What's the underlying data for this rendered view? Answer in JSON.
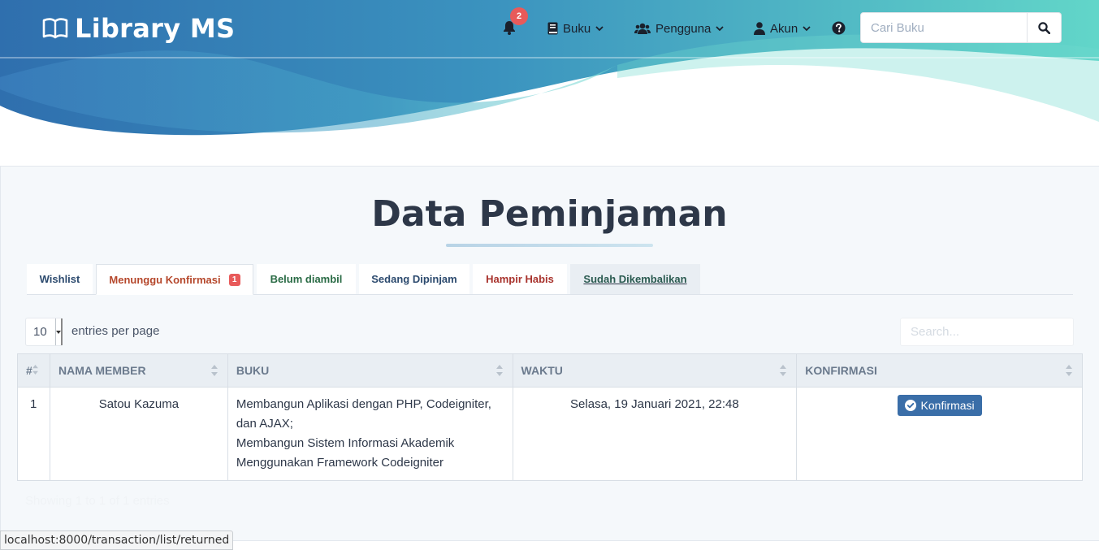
{
  "brand": {
    "name": "Library MS"
  },
  "notifications": {
    "count": "2"
  },
  "nav": {
    "buku": "Buku",
    "pengguna": "Pengguna",
    "akun": "Akun",
    "search_placeholder": "Cari Buku"
  },
  "page": {
    "title": "Data Peminjaman"
  },
  "tabs": [
    {
      "label": "Wishlist",
      "color": "#2c4a6e"
    },
    {
      "label": "Menunggu Konfirmasi",
      "badge": "1",
      "color": "#b5472b"
    },
    {
      "label": "Belum diambil",
      "color": "#2a6b45"
    },
    {
      "label": "Sedang Dipinjam",
      "color": "#2c4a6e"
    },
    {
      "label": "Hampir Habis",
      "color": "#a8322c"
    },
    {
      "label": "Sudah Dikembalikan",
      "color": "#2a5a50"
    }
  ],
  "table_controls": {
    "entries_value": "10",
    "entries_label": "entries per page",
    "search_placeholder": "Search..."
  },
  "table": {
    "headers": [
      "#",
      "NAMA MEMBER",
      "BUKU",
      "WAKTU",
      "KONFIRMASI"
    ],
    "rows": [
      {
        "no": "1",
        "member": "Satou Kazuma",
        "book_1": "Membangun Aplikasi dengan PHP, Codeigniter, dan AJAX;",
        "book_2": "Membangun Sistem Informasi Akademik Menggunakan Framework Codeigniter",
        "time": "Selasa, 19 Januari 2021, 22:48",
        "action": "Konfirmasi"
      }
    ]
  },
  "info": "Showing 1 to 1 of 1 entries",
  "status_bar": "localhost:8000/transaction/list/returned",
  "colors": {
    "header_start": "#2f6fae",
    "header_end": "#5cd3c8",
    "accent_button": "#3a6ea8",
    "badge": "#e85a5a"
  }
}
